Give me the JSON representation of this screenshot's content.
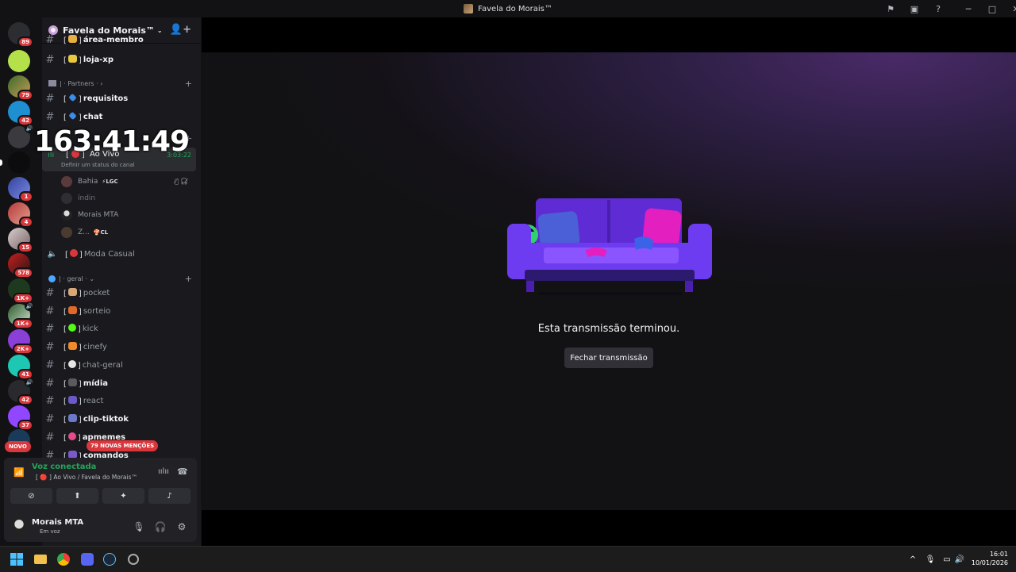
{
  "window": {
    "title": "Favela do Morais™"
  },
  "server": {
    "name": "Favela do Morais™"
  },
  "rail_badges": [
    "89",
    "79",
    "42",
    "1",
    "4",
    "15",
    "578",
    "1K+",
    "1K+",
    "2K+",
    "41",
    "42",
    "37"
  ],
  "rail_new_label": "NOVO",
  "channels_top": {
    "cut_name": "área-membro",
    "loja_xp": "loja-xp"
  },
  "partners": {
    "category": "| · Partners · ›",
    "items": [
      "requisitos",
      "chat"
    ]
  },
  "live": {
    "name": "Ao Vivo",
    "time": "3:03:22",
    "status_prompt": "Definir um status do canal"
  },
  "voice_users": [
    {
      "name": "Bahia",
      "tag": "⚡LGC"
    },
    {
      "name": "índin",
      "tag": ""
    },
    {
      "name": "Morais MTA",
      "tag": ""
    },
    {
      "name": "Z...",
      "tag": "🍄CL"
    }
  ],
  "moda_casual": "Moda Casual",
  "geral": {
    "category": "| · geral · ⌄",
    "items": [
      "pocket",
      "sorteio",
      "kick",
      "cinefy",
      "chat-geral",
      "mídia",
      "react",
      "clip-tiktok",
      "apmemes",
      "comandos"
    ]
  },
  "mentions_label": "79 NOVAS MENÇÕES",
  "timer": "163:41:49",
  "voice_panel": {
    "status": "Voz conectada",
    "sub": "[ 🔴 ] Ao Vivo / Favela do Morais™"
  },
  "user": {
    "name": "Morais MTA",
    "status": "Em voz"
  },
  "stream": {
    "ended_message": "Esta transmissão terminou.",
    "close_label": "Fechar transmissão"
  },
  "clock": {
    "time": "16:01",
    "date": "10/01/2026"
  },
  "colors": {
    "accent_red": "#da373c",
    "voice_green": "#23a55a",
    "sofa_purple": "#5e2bd4",
    "pillow_pink": "#e31fbf"
  }
}
